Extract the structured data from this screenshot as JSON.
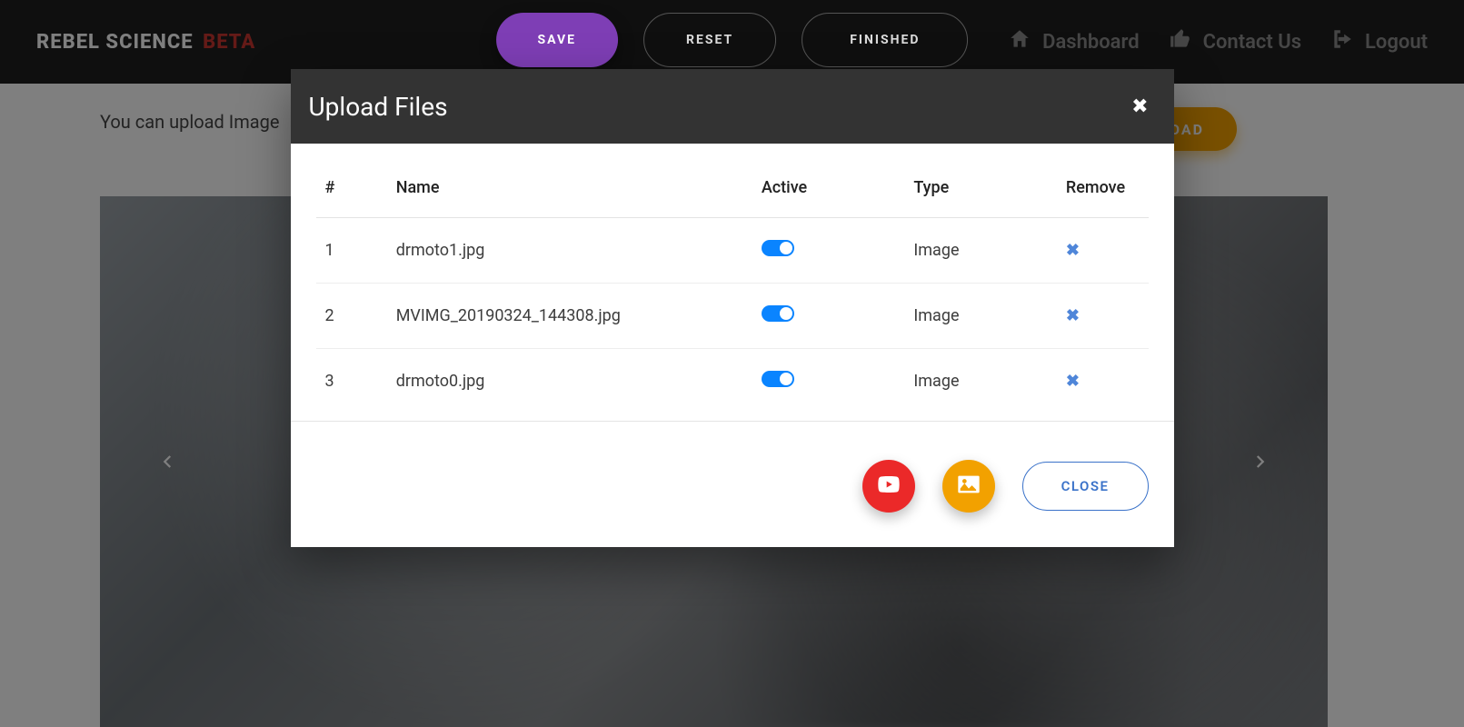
{
  "brand": {
    "name": "REBEL SCIENCE",
    "suffix": "BETA"
  },
  "nav": {
    "dashboard": "Dashboard",
    "contact": "Contact Us",
    "logout": "Logout"
  },
  "actions": {
    "save": "SAVE",
    "reset": "RESET",
    "finished": "FINISHED"
  },
  "page": {
    "hint": "You can upload Image",
    "upload_btn": "UPLOAD"
  },
  "modal": {
    "title": "Upload Files",
    "headers": {
      "num": "#",
      "name": "Name",
      "active": "Active",
      "type": "Type",
      "remove": "Remove"
    },
    "rows": [
      {
        "num": "1",
        "name": "drmoto1.jpg",
        "active": true,
        "type": "Image"
      },
      {
        "num": "2",
        "name": "MVIMG_20190324_144308.jpg",
        "active": true,
        "type": "Image"
      },
      {
        "num": "3",
        "name": "drmoto0.jpg",
        "active": true,
        "type": "Image"
      }
    ],
    "close_btn": "CLOSE"
  }
}
